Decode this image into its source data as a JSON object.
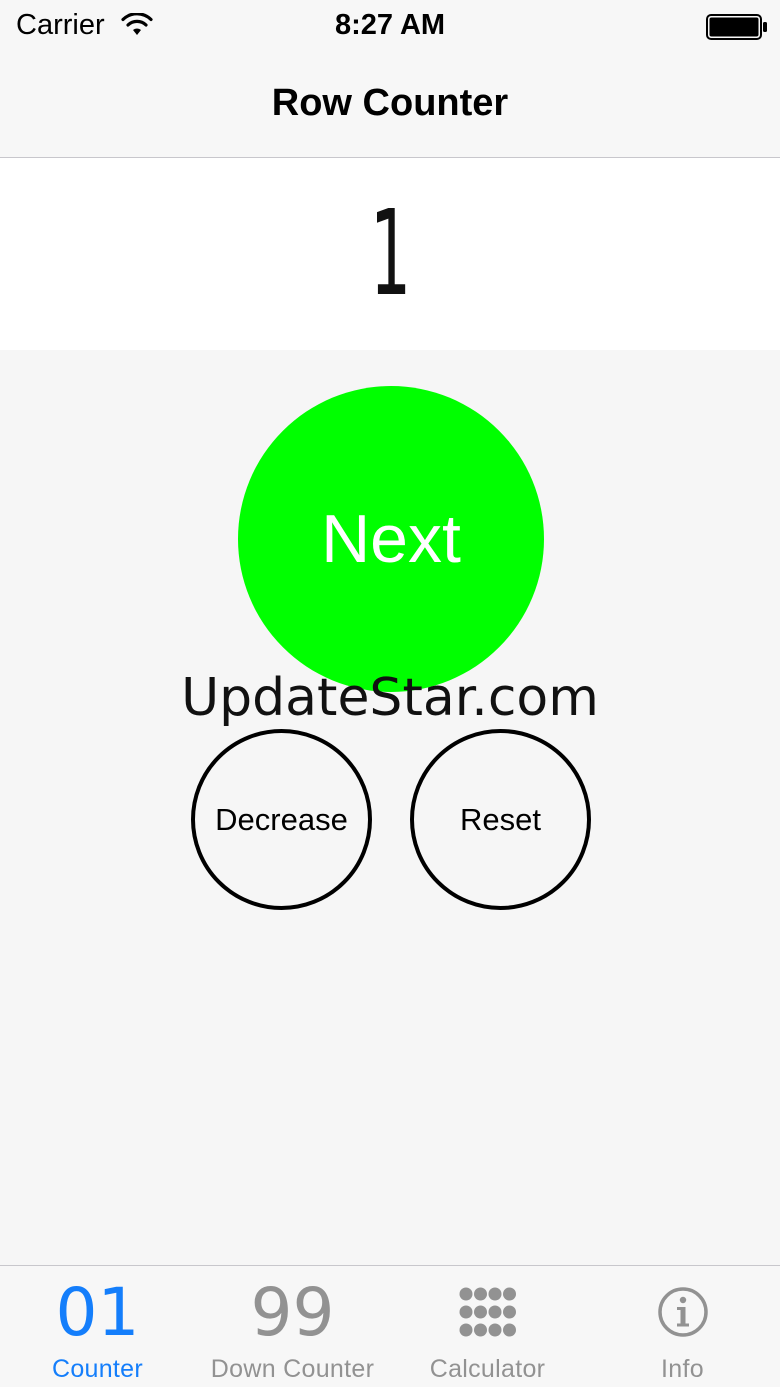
{
  "status_bar": {
    "carrier": "Carrier",
    "time": "8:27 AM",
    "icons": [
      "wifi-icon",
      "battery-icon"
    ]
  },
  "nav": {
    "title": "Row Counter"
  },
  "counter": {
    "value": "1"
  },
  "buttons": {
    "next": "Next",
    "decrease": "Decrease",
    "reset": "Reset"
  },
  "watermark": "UpdateStar.com",
  "tabs": [
    {
      "glyph": "01",
      "label": "Counter",
      "active": true
    },
    {
      "glyph": "99",
      "label": "Down Counter",
      "active": false
    },
    {
      "icon": "keypad-grid-icon",
      "label": "Calculator",
      "active": false
    },
    {
      "icon": "info-icon",
      "label": "Info",
      "active": false
    }
  ],
  "colors": {
    "next_button": "#00ff00",
    "tab_active": "#147efb",
    "tab_inactive": "#929292"
  }
}
